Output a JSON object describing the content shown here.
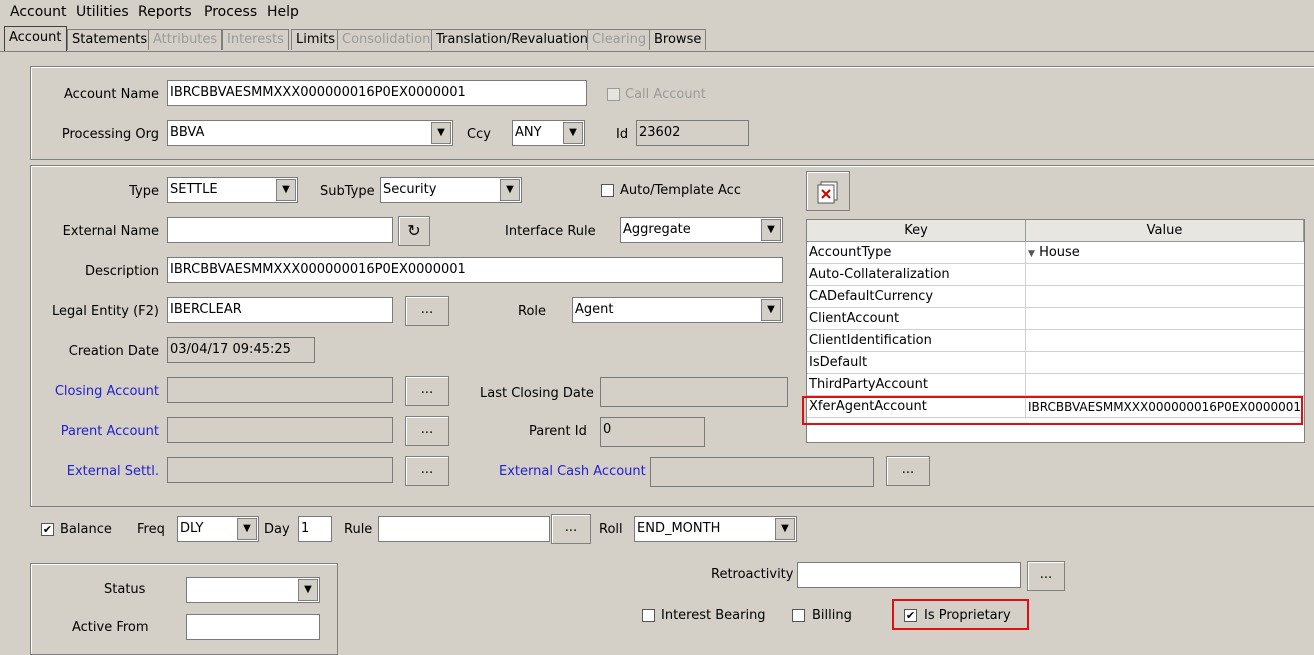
{
  "menu": [
    "Account",
    "Utilities",
    "Reports",
    "Process",
    "Help"
  ],
  "tabs": [
    {
      "label": "Account",
      "state": "active"
    },
    {
      "label": "Statements",
      "state": "normal"
    },
    {
      "label": "Attributes",
      "state": "disabled"
    },
    {
      "label": "Interests",
      "state": "disabled"
    },
    {
      "label": "Limits",
      "state": "normal"
    },
    {
      "label": "Consolidation",
      "state": "disabled"
    },
    {
      "label": "Translation/Revaluation",
      "state": "normal"
    },
    {
      "label": "Clearing",
      "state": "disabled"
    },
    {
      "label": "Browse",
      "state": "normal"
    }
  ],
  "top": {
    "account_name_label": "Account Name",
    "account_name_value": "IBRCBBVAESMMXXX000000016P0EX0000001",
    "call_account_label": "Call Account",
    "processing_org_label": "Processing Org",
    "processing_org_value": "BBVA",
    "ccy_label": "Ccy",
    "ccy_value": "ANY",
    "id_label": "Id",
    "id_value": "23602"
  },
  "detail": {
    "type_label": "Type",
    "type_value": "SETTLE",
    "subtype_label": "SubType",
    "subtype_value": "Security",
    "auto_template_label": "Auto/Template Acc",
    "external_name_label": "External Name",
    "external_name_value": "",
    "interface_rule_label": "Interface Rule",
    "interface_rule_value": "Aggregate",
    "description_label": "Description",
    "description_value": "IBRCBBVAESMMXXX000000016P0EX0000001",
    "legal_entity_label": "Legal Entity (F2)",
    "legal_entity_value": "IBERCLEAR",
    "role_label": "Role",
    "role_value": "Agent",
    "creation_date_label": "Creation Date",
    "creation_date_value": "03/04/17 09:45:25",
    "closing_account_label": "Closing Account",
    "last_closing_date_label": "Last Closing Date",
    "parent_account_label": "Parent Account",
    "parent_id_label": "Parent Id",
    "parent_id_value": "0",
    "external_settl_label": "External Settl.",
    "external_cash_label": "External Cash Account",
    "ellipsis": "..."
  },
  "attributes": {
    "key_header": "Key",
    "value_header": "Value",
    "rows": [
      {
        "key": "AccountType",
        "value": "House",
        "has_dropdown": true
      },
      {
        "key": "Auto-Collateralization",
        "value": ""
      },
      {
        "key": "CADefaultCurrency",
        "value": ""
      },
      {
        "key": "ClientAccount",
        "value": ""
      },
      {
        "key": "ClientIdentification",
        "value": ""
      },
      {
        "key": "IsDefault",
        "value": ""
      },
      {
        "key": "ThirdPartyAccount",
        "value": ""
      },
      {
        "key": "XferAgentAccount",
        "value": "IBRCBBVAESMMXXX000000016P0EX0000001"
      }
    ]
  },
  "balance": {
    "balance_label": "Balance",
    "balance_checked": true,
    "freq_label": "Freq",
    "freq_value": "DLY",
    "day_label": "Day",
    "day_value": "1",
    "rule_label": "Rule",
    "rule_value": "",
    "roll_label": "Roll",
    "roll_value": "END_MONTH"
  },
  "bottom": {
    "status_label": "Status",
    "status_value": "",
    "active_from_label": "Active From",
    "retroactivity_label": "Retroactivity",
    "retroactivity_value": "",
    "interest_bearing_label": "Interest Bearing",
    "billing_label": "Billing",
    "is_proprietary_label": "Is Proprietary",
    "is_proprietary_checked": true
  },
  "colors": {
    "highlight": "#e01010",
    "link": "#2020d0",
    "window_bg": "#d4d0c8"
  }
}
